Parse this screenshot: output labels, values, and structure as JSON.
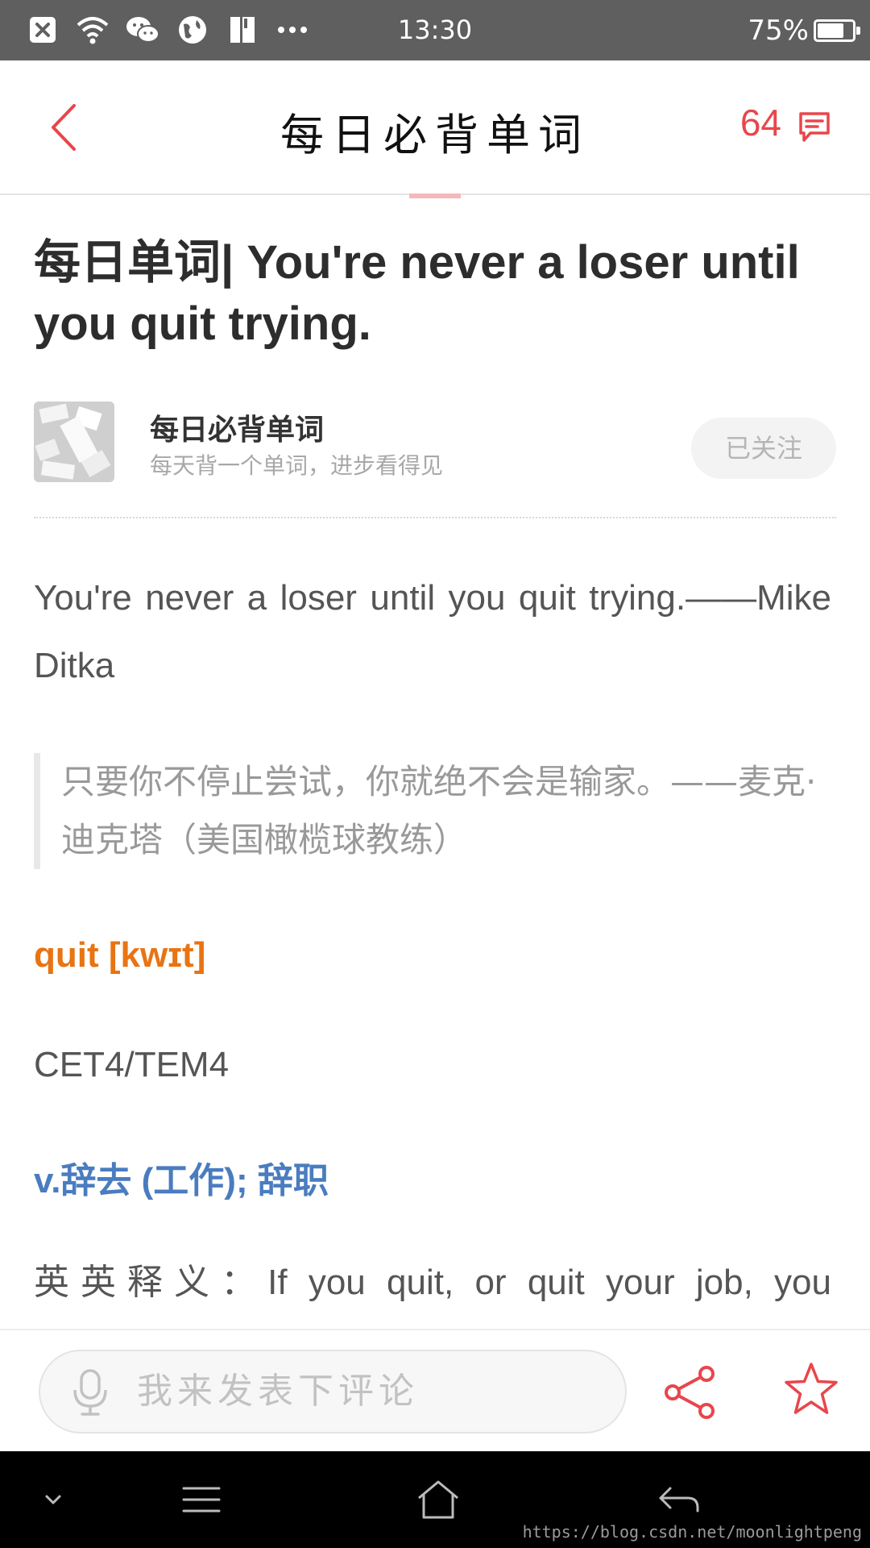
{
  "status_bar": {
    "time": "13:30",
    "battery": "75%",
    "battery_level": 0.75,
    "icons": [
      "close-box-icon",
      "wifi-icon",
      "wechat-icon",
      "globe-icon",
      "book-icon",
      "more-icon"
    ]
  },
  "header": {
    "title": "每日必背单词",
    "comment_count": "64",
    "icons": [
      "back-chevron-icon",
      "comment-bubble-icon"
    ]
  },
  "article": {
    "title": "每日单词| You're never a loser until you quit trying.",
    "author_name": "每日必背单词",
    "author_desc": "每天背一个单词，进步看得见",
    "follow_label": "已关注",
    "quote_en": "You're never a loser until you quit trying.——Mike Ditka",
    "quote_cn": "只要你不停止尝试，你就绝不会是输家。——麦克·迪克塔（美国橄榄球教练）",
    "word": "quit [kwɪt]",
    "level": "CET4/TEM4",
    "meaning": "v.辞去 (工作); 辞职",
    "english_def": "英英释义：If you quit, or quit your job, you"
  },
  "comment_bar": {
    "placeholder": "我来发表下评论",
    "icons": [
      "microphone-icon",
      "share-icon",
      "star-icon"
    ]
  },
  "nav_bar": {
    "icons": [
      "chevron-down-icon",
      "menu-icon",
      "home-icon",
      "back-arrow-icon"
    ],
    "watermark": "https://blog.csdn.net/moonlightpeng"
  },
  "colors": {
    "accent_red": "#e8464c",
    "word_orange": "#e87413",
    "meaning_blue": "#4a7cbf",
    "status_bar_bg": "#5f5f5f"
  }
}
